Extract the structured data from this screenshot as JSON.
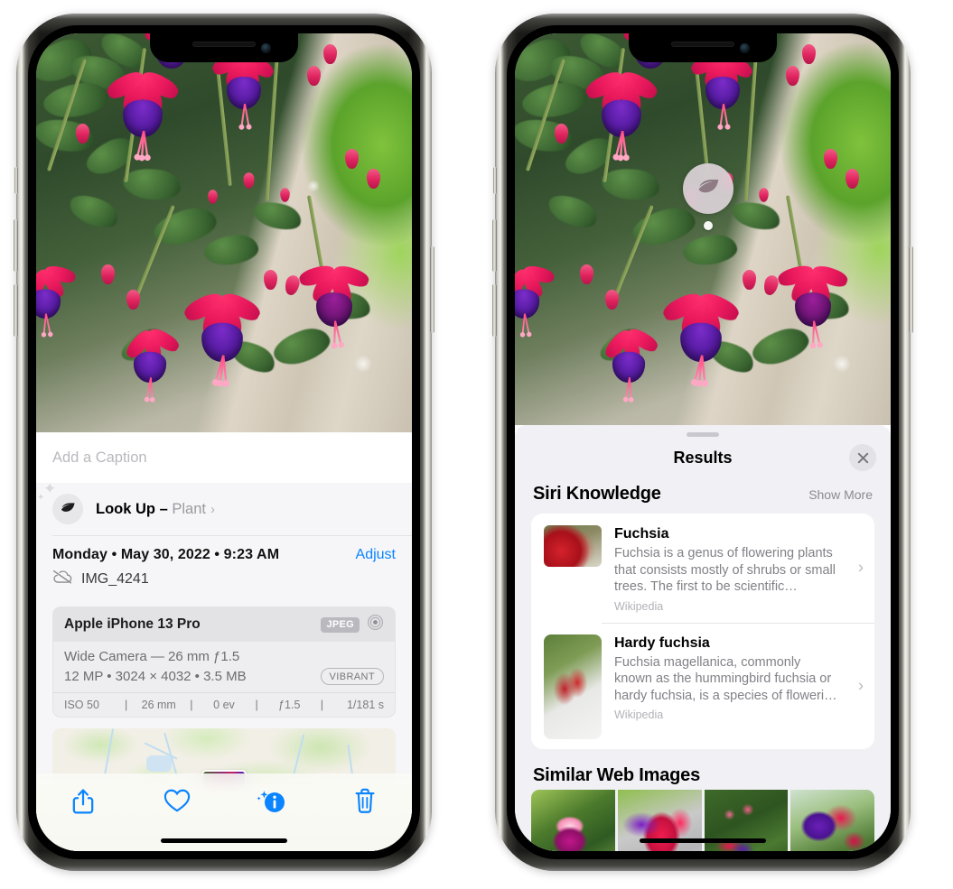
{
  "left_phone": {
    "caption_placeholder": "Add a Caption",
    "lookup": {
      "icon": "leaf-icon",
      "label": "Look Up – ",
      "subject": "Plant",
      "chevron": "›"
    },
    "info": {
      "date": "Monday • May 30, 2022 • 9:23 AM",
      "adjust_label": "Adjust",
      "cloud_icon": "icloud-slash-icon",
      "filename": "IMG_4241"
    },
    "exif": {
      "device": "Apple iPhone 13 Pro",
      "format_badge": "JPEG",
      "aperture_icon": "aperture-icon",
      "lens_line": "Wide Camera — 26 mm ƒ1.5",
      "resolution_line": "12 MP • 3024 × 4032 • 3.5 MB",
      "style_badge": "VIBRANT",
      "stats": [
        "ISO 50",
        "26 mm",
        "0 ev",
        "ƒ1.5",
        "1/181 s"
      ]
    },
    "toolbar": {
      "share_icon": "share-icon",
      "favorite_icon": "heart-icon",
      "info_icon": "info-sparkle-icon",
      "delete_icon": "trash-icon"
    }
  },
  "right_phone": {
    "visual_lookup_pin": "leaf-icon",
    "panel": {
      "title": "Results",
      "close_icon": "close-icon",
      "grabber": "drag-handle"
    },
    "siri_knowledge": {
      "title": "Siri Knowledge",
      "show_more": "Show More",
      "items": [
        {
          "title": "Fuchsia",
          "description": "Fuchsia is a genus of flowering plants that consists mostly of shrubs or small trees. The first to be scientific…",
          "source": "Wikipedia",
          "chevron": "›"
        },
        {
          "title": "Hardy fuchsia",
          "description": "Fuchsia magellanica, commonly known as the hummingbird fuchsia or hardy fuchsia, is a species of floweri…",
          "source": "Wikipedia",
          "chevron": "›"
        }
      ]
    },
    "similar_web_images": {
      "title": "Similar Web Images",
      "count": 4
    }
  },
  "colors": {
    "accent_blue": "#0a84ff",
    "panel_bg": "#f1f1f5",
    "card_bg": "#ffffff",
    "secondary_text": "#8a8a90"
  }
}
